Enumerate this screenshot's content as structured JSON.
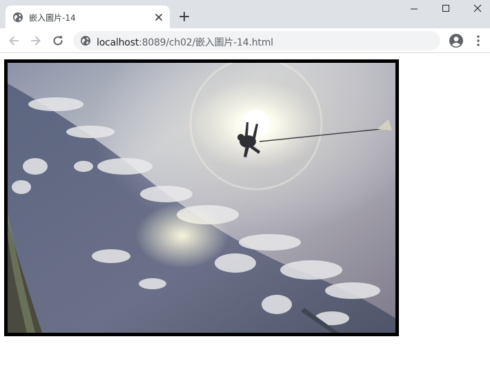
{
  "browser": {
    "tab": {
      "title": "嵌入圖片-14"
    },
    "address_bar": {
      "host": "localhost",
      "rest": ":8089/ch02/嵌入圖片-14.html"
    }
  },
  "page": {
    "image": {
      "subject": "skydiver-photo"
    }
  },
  "colors": {
    "titlebar": "#dee1e6",
    "omnibox": "#f1f3f4",
    "image_border": "#000000"
  }
}
